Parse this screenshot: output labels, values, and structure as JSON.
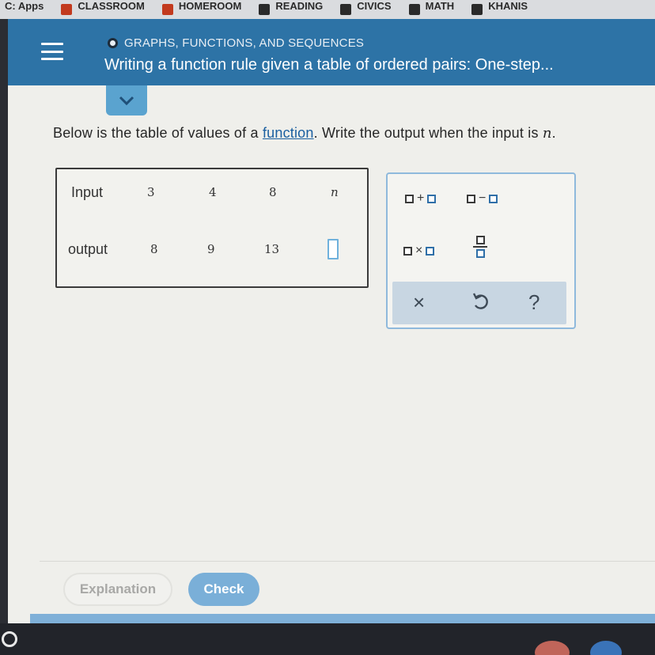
{
  "bookmarks": [
    {
      "label": "C: Apps",
      "icon": "bookmark-icon"
    },
    {
      "label": "CLASSROOM",
      "icon": "bookmark-icon"
    },
    {
      "label": "HOMEROOM",
      "icon": "bookmark-icon"
    },
    {
      "label": "READING",
      "icon": "bookmark-icon"
    },
    {
      "label": "CIVICS",
      "icon": "bookmark-icon"
    },
    {
      "label": "MATH",
      "icon": "bookmark-icon"
    },
    {
      "label": "KHANIS",
      "icon": "bookmark-icon"
    }
  ],
  "header": {
    "topic": "GRAPHS, FUNCTIONS, AND SEQUENCES",
    "title": "Writing a function rule given a table of ordered pairs: One-step...",
    "menu_icon": "hamburger-menu-icon",
    "expand_icon": "chevron-down-icon"
  },
  "question": {
    "before": "Below is the table of values of a ",
    "link": "function",
    "middle": ". Write the output when the input is ",
    "variable": "n",
    "after": "."
  },
  "table": {
    "input_label": "Input",
    "output_label": "output",
    "inputs": [
      "3",
      "4",
      "8",
      "n"
    ],
    "outputs": [
      "8",
      "9",
      "13"
    ]
  },
  "keypad": {
    "add": "+",
    "subtract": "−",
    "multiply": "×",
    "fraction_icon": "fraction-icon",
    "clear": "×",
    "undo_icon": "undo-icon",
    "help": "?"
  },
  "footer": {
    "explanation": "Explanation",
    "check": "Check"
  },
  "colors": {
    "header": "#2d73a6",
    "accent": "#5aa3cf",
    "check_button": "#7aafd8"
  }
}
